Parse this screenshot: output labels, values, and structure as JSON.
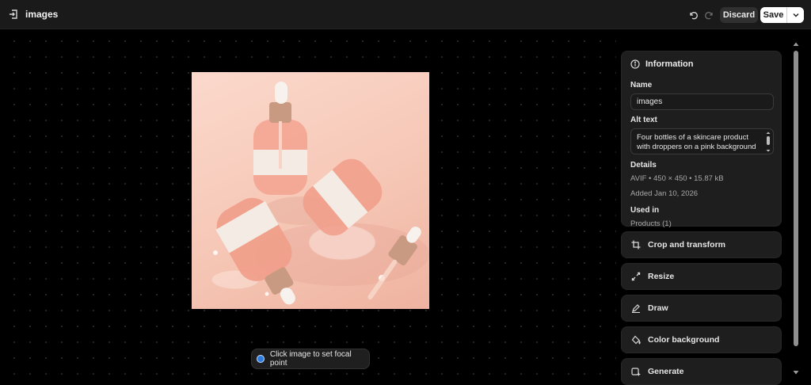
{
  "topbar": {
    "title": "images",
    "discard_label": "Discard",
    "save_label": "Save",
    "icons": {
      "exit": "exit-icon",
      "undo": "undo-icon",
      "redo": "redo-icon",
      "more": "chevron-down-icon"
    }
  },
  "canvas": {
    "focal_hint": "Click image to set focal point",
    "focal_dot_color": "#2b7be0"
  },
  "panel": {
    "information": {
      "heading": "Information",
      "name_label": "Name",
      "name_value": "images",
      "alt_label": "Alt text",
      "alt_value": "Four bottles of a skincare product with droppers on a pink background",
      "details_label": "Details",
      "details_value": "AVIF • 450 × 450 • 15.87 kB",
      "added_value": "Added Jan 10, 2026",
      "used_in_label": "Used in",
      "used_in_value": "Products (1)"
    },
    "tools": [
      {
        "label": "Crop and transform",
        "icon": "crop-icon"
      },
      {
        "label": "Resize",
        "icon": "resize-icon"
      },
      {
        "label": "Draw",
        "icon": "draw-icon"
      },
      {
        "label": "Color background",
        "icon": "paint-bucket-icon"
      },
      {
        "label": "Generate",
        "icon": "generate-icon"
      }
    ]
  },
  "colors": {
    "background": "#000000",
    "topbar": "#1a1a1a",
    "card": "#1e1e1e",
    "save_button": "#ffffff",
    "discard_button": "#303030"
  }
}
